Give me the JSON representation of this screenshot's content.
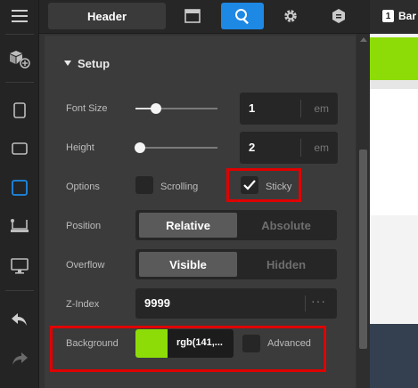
{
  "topbar": {
    "header_label": "Header",
    "icons": [
      "layout-icon",
      "search-icon",
      "gear-icon",
      "shield-icon"
    ],
    "accent": "#1e88e5"
  },
  "rail": {
    "icons": [
      "menu-icon",
      "add-block-icon",
      "mobile-icon",
      "tablet-landscape-icon",
      "tablet-icon",
      "laptop-icon",
      "desktop-icon",
      "undo-icon",
      "redo-icon"
    ]
  },
  "section": {
    "title": "Setup"
  },
  "font_size": {
    "label": "Font Size",
    "value": "1",
    "unit": "em",
    "slider_level": 0.25
  },
  "height": {
    "label": "Height",
    "value": "2",
    "unit": "em",
    "slider_level": 0.05
  },
  "options": {
    "label": "Options",
    "scrolling_label": "Scrolling",
    "sticky_label": "Sticky",
    "scrolling_checked": false,
    "sticky_checked": true
  },
  "position": {
    "label": "Position",
    "options": [
      "Relative",
      "Absolute"
    ],
    "selected": "Relative"
  },
  "overflow": {
    "label": "Overflow",
    "options": [
      "Visible",
      "Hidden"
    ],
    "selected": "Visible"
  },
  "zindex": {
    "label": "Z-Index",
    "value": "9999",
    "more": "···"
  },
  "background": {
    "label": "Background",
    "color_text": "rgb(141,...",
    "swatch": "#8ddc08",
    "advanced_label": "Advanced",
    "advanced_checked": false
  },
  "preview": {
    "tab_number": "1",
    "tab_label": "Bar"
  },
  "highlight_color": "#e00000"
}
